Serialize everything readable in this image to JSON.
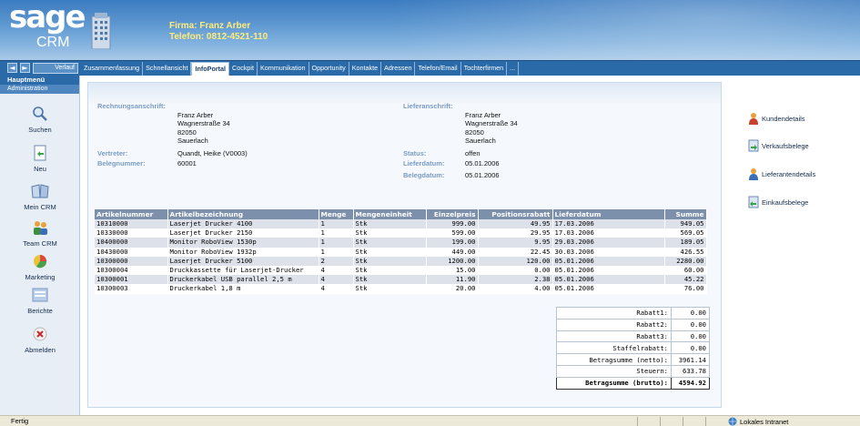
{
  "header": {
    "brand": "sage",
    "product": "CRM",
    "firma_line": "Firma: Franz Arber",
    "telefon_line": "Telefon: 0812-4521-110"
  },
  "nav": {
    "back": "◄",
    "forward": "►",
    "verlauf": "Verlauf",
    "tabs": [
      "Zusammenfassung",
      "Schnellansicht",
      "InfoPortal",
      "Cockpit",
      "Kommunikation",
      "Opportunity",
      "Kontakte",
      "Adressen",
      "Telefon/Email",
      "Tochterfirmen",
      "..."
    ],
    "active_tab": "InfoPortal"
  },
  "sidebar": {
    "hauptmenu": "Hauptmenü",
    "administration": "Administration",
    "items": [
      {
        "label": "Suchen",
        "icon": "magnifier-icon"
      },
      {
        "label": "Neu",
        "icon": "new-document-icon"
      },
      {
        "label": "Mein CRM",
        "icon": "book-icon"
      },
      {
        "label": "Team CRM",
        "icon": "team-icon"
      },
      {
        "label": "Marketing",
        "icon": "pie-chart-icon"
      },
      {
        "label": "Berichte",
        "icon": "report-icon"
      },
      {
        "label": "Abmelden",
        "icon": "logout-icon"
      }
    ]
  },
  "info": {
    "rechnung_label": "Rechnungsanschrift:",
    "rechnung_lines": [
      "Franz Arber",
      "Wagnerstraße 34",
      "82050",
      "Sauerlach"
    ],
    "liefer_label": "Lieferanschrift:",
    "liefer_lines": [
      "Franz Arber",
      "Wagnerstraße 34",
      "82050",
      "Sauerlach"
    ],
    "vertreter_label": "Vertreter:",
    "vertreter_value": "Quandt, Heike (V0003)",
    "belegnummer_label": "Belegnummer:",
    "belegnummer_value": "60001",
    "status_label": "Status:",
    "status_value": "offen",
    "lieferdatum_label": "Lieferdatum:",
    "lieferdatum_value": "05.01.2006",
    "belegdatum_label": "Belegdatum:",
    "belegdatum_value": "05.01.2006"
  },
  "table": {
    "headers": [
      "Artikelnummer",
      "Artikelbezeichnung",
      "Menge",
      "Mengeneinheit",
      "Einzelpreis",
      "Positionsrabatt",
      "Lieferdatum",
      "Summe"
    ],
    "rows": [
      [
        "10310000",
        "Laserjet Drucker 4100",
        "1",
        "Stk",
        "999.00",
        "49.95",
        "17.03.2006",
        "949.05"
      ],
      [
        "10330000",
        "Laserjet Drucker 2150",
        "1",
        "Stk",
        "599.00",
        "29.95",
        "17.03.2006",
        "569.05"
      ],
      [
        "10400000",
        "Monitor RoboView 1530p",
        "1",
        "Stk",
        "199.00",
        "9.95",
        "29.03.2006",
        "189.05"
      ],
      [
        "10430000",
        "Monitor RoboView 1932p",
        "1",
        "Stk",
        "449.00",
        "22.45",
        "30.03.2006",
        "426.55"
      ],
      [
        "10300000",
        "Laserjet Drucker 5100",
        "2",
        "Stk",
        "1200.00",
        "120.00",
        "05.01.2006",
        "2280.00"
      ],
      [
        "10300004",
        "Druckkassette für Laserjet-Drucker",
        "4",
        "Stk",
        "15.00",
        "0.00",
        "05.01.2006",
        "60.00"
      ],
      [
        "10300001",
        "Druckerkabel USB parallel 2,5 m",
        "4",
        "Stk",
        "11.90",
        "2.38",
        "05.01.2006",
        "45.22"
      ],
      [
        "10300003",
        "Druckerkabel 1,8 m",
        "4",
        "Stk",
        "20.00",
        "4.00",
        "05.01.2006",
        "76.00"
      ]
    ]
  },
  "totals": [
    {
      "label": "Rabatt1:",
      "value": "0.00"
    },
    {
      "label": "Rabatt2:",
      "value": "0.00"
    },
    {
      "label": "Rabatt3:",
      "value": "0.00"
    },
    {
      "label": "Staffelrabatt:",
      "value": "0.00"
    },
    {
      "label": "Betragsumme (netto):",
      "value": "3961.14"
    },
    {
      "label": "Steuern:",
      "value": "633.78"
    },
    {
      "label": "Betragsumme (brutto):",
      "value": "4594.92"
    }
  ],
  "right_links": [
    {
      "label": "Kundendetails",
      "icon": "person-icon"
    },
    {
      "label": "Verkaufsbelege",
      "icon": "document-arrow-icon"
    },
    {
      "label": "Lieferantendetails",
      "icon": "person-icon"
    },
    {
      "label": "Einkaufsbelege",
      "icon": "document-arrow-icon"
    }
  ],
  "statusbar": {
    "left": "Fertig",
    "right": "Lokales Intranet"
  }
}
